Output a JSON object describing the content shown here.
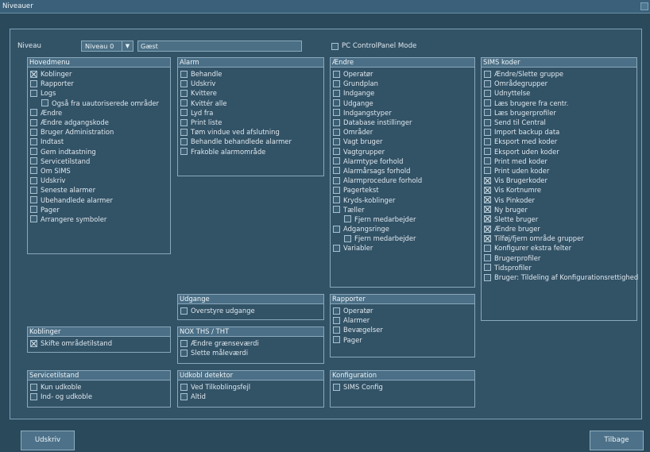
{
  "window": {
    "title": "Niveauer"
  },
  "niveau": {
    "label": "Niveau",
    "selected": "Niveau 0",
    "name": "Gæst"
  },
  "pc_mode": {
    "label": "PC ControlPanel Mode",
    "checked": false
  },
  "groups": {
    "hovedmenu": {
      "title": "Hovedmenu",
      "items": [
        {
          "label": "Koblinger",
          "checked": true
        },
        {
          "label": "Rapporter",
          "checked": false
        },
        {
          "label": "Logs",
          "checked": false
        },
        {
          "label": "Også fra uautoriserede områder",
          "checked": false,
          "indent": true
        },
        {
          "label": "Ændre",
          "checked": false
        },
        {
          "label": "Ændre adgangskode",
          "checked": false
        },
        {
          "label": "Bruger Administration",
          "checked": false
        },
        {
          "label": "Indtast",
          "checked": false
        },
        {
          "label": "Gem indtastning",
          "checked": false
        },
        {
          "label": "Servicetilstand",
          "checked": false
        },
        {
          "label": "Om SIMS",
          "checked": false
        },
        {
          "label": "Udskriv",
          "checked": false
        },
        {
          "label": "Seneste alarmer",
          "checked": false
        },
        {
          "label": "Ubehandlede alarmer",
          "checked": false
        },
        {
          "label": "Pager",
          "checked": false
        },
        {
          "label": "Arrangere symboler",
          "checked": false
        }
      ]
    },
    "alarm": {
      "title": "Alarm",
      "items": [
        {
          "label": "Behandle",
          "checked": false
        },
        {
          "label": "Udskriv",
          "checked": false
        },
        {
          "label": "Kvittere",
          "checked": false
        },
        {
          "label": "Kvittér alle",
          "checked": false
        },
        {
          "label": "Lyd fra",
          "checked": false
        },
        {
          "label": "Print liste",
          "checked": false
        },
        {
          "label": "Tøm vindue ved afslutning",
          "checked": false
        },
        {
          "label": "Behandle behandlede alarmer",
          "checked": false
        },
        {
          "label": "Frakoble alarmområde",
          "checked": false
        }
      ]
    },
    "aendre": {
      "title": "Ændre",
      "items": [
        {
          "label": "Operatør",
          "checked": false
        },
        {
          "label": "Grundplan",
          "checked": false
        },
        {
          "label": "Indgange",
          "checked": false
        },
        {
          "label": "Udgange",
          "checked": false
        },
        {
          "label": "Indgangstyper",
          "checked": false
        },
        {
          "label": "Database instillinger",
          "checked": false
        },
        {
          "label": "Områder",
          "checked": false
        },
        {
          "label": "Vagt bruger",
          "checked": false
        },
        {
          "label": "Vagtgrupper",
          "checked": false
        },
        {
          "label": "Alarmtype forhold",
          "checked": false
        },
        {
          "label": "Alarmårsags forhold",
          "checked": false
        },
        {
          "label": "Alarmprocedure forhold",
          "checked": false
        },
        {
          "label": "Pagertekst",
          "checked": false
        },
        {
          "label": "Kryds-koblinger",
          "checked": false
        },
        {
          "label": "Tæller",
          "checked": false
        },
        {
          "label": "Fjern medarbejder",
          "checked": false,
          "indent": true
        },
        {
          "label": "Adgangsringe",
          "checked": false
        },
        {
          "label": "Fjern medarbejder",
          "checked": false,
          "indent": true
        },
        {
          "label": "Variabler",
          "checked": false
        }
      ]
    },
    "sims_koder": {
      "title": "SIMS koder",
      "items": [
        {
          "label": "Ændre/Slette gruppe",
          "checked": false
        },
        {
          "label": "Områdegrupper",
          "checked": false
        },
        {
          "label": "Udnyttelse",
          "checked": false
        },
        {
          "label": "Læs brugere fra centr.",
          "checked": false
        },
        {
          "label": "Læs brugerprofiler",
          "checked": false
        },
        {
          "label": "Send til Central",
          "checked": false
        },
        {
          "label": "Import backup data",
          "checked": false
        },
        {
          "label": "Eksport med koder",
          "checked": false
        },
        {
          "label": "Eksport uden koder",
          "checked": false
        },
        {
          "label": "Print med koder",
          "checked": false
        },
        {
          "label": "Print uden koder",
          "checked": false
        },
        {
          "label": "Vis Brugerkoder",
          "checked": true
        },
        {
          "label": "Vis Kortnumre",
          "checked": true
        },
        {
          "label": "Vis Pinkoder",
          "checked": true
        },
        {
          "label": "Ny bruger",
          "checked": true
        },
        {
          "label": "Slette bruger",
          "checked": true
        },
        {
          "label": "Ændre bruger",
          "checked": true
        },
        {
          "label": "Tilføj/fjern område grupper",
          "checked": true
        },
        {
          "label": "Konfigurer ekstra felter",
          "checked": false
        },
        {
          "label": "Brugerprofiler",
          "checked": false
        },
        {
          "label": "Tidsprofiler",
          "checked": false
        },
        {
          "label": "Bruger: Tildeling af Konfigurationsrettighed",
          "checked": false
        }
      ]
    },
    "udgange": {
      "title": "Udgange",
      "items": [
        {
          "label": "Overstyre udgange",
          "checked": false
        }
      ]
    },
    "rapporter": {
      "title": "Rapporter",
      "items": [
        {
          "label": "Operatør",
          "checked": false
        },
        {
          "label": "Alarmer",
          "checked": false
        },
        {
          "label": "Bevægelser",
          "checked": false
        },
        {
          "label": "Pager",
          "checked": false
        }
      ]
    },
    "koblinger": {
      "title": "Koblinger",
      "items": [
        {
          "label": "Skifte områdetilstand",
          "checked": true
        }
      ]
    },
    "nox": {
      "title": "NOX THS / THT",
      "items": [
        {
          "label": "Ændre grænseværdi",
          "checked": false
        },
        {
          "label": "Slette måleværdi",
          "checked": false
        }
      ]
    },
    "servicetilstand": {
      "title": "Servicetilstand",
      "items": [
        {
          "label": "Kun udkoble",
          "checked": false
        },
        {
          "label": "Ind- og udkoble",
          "checked": false
        }
      ]
    },
    "udkobl": {
      "title": "Udkobl detektor",
      "items": [
        {
          "label": "Ved Tilkoblingsfejl",
          "checked": false
        },
        {
          "label": "Altid",
          "checked": false
        }
      ]
    },
    "konfiguration": {
      "title": "Konfiguration",
      "items": [
        {
          "label": "SIMS Config",
          "checked": false
        }
      ]
    }
  },
  "buttons": {
    "print": "Udskriv",
    "back": "Tilbage"
  }
}
